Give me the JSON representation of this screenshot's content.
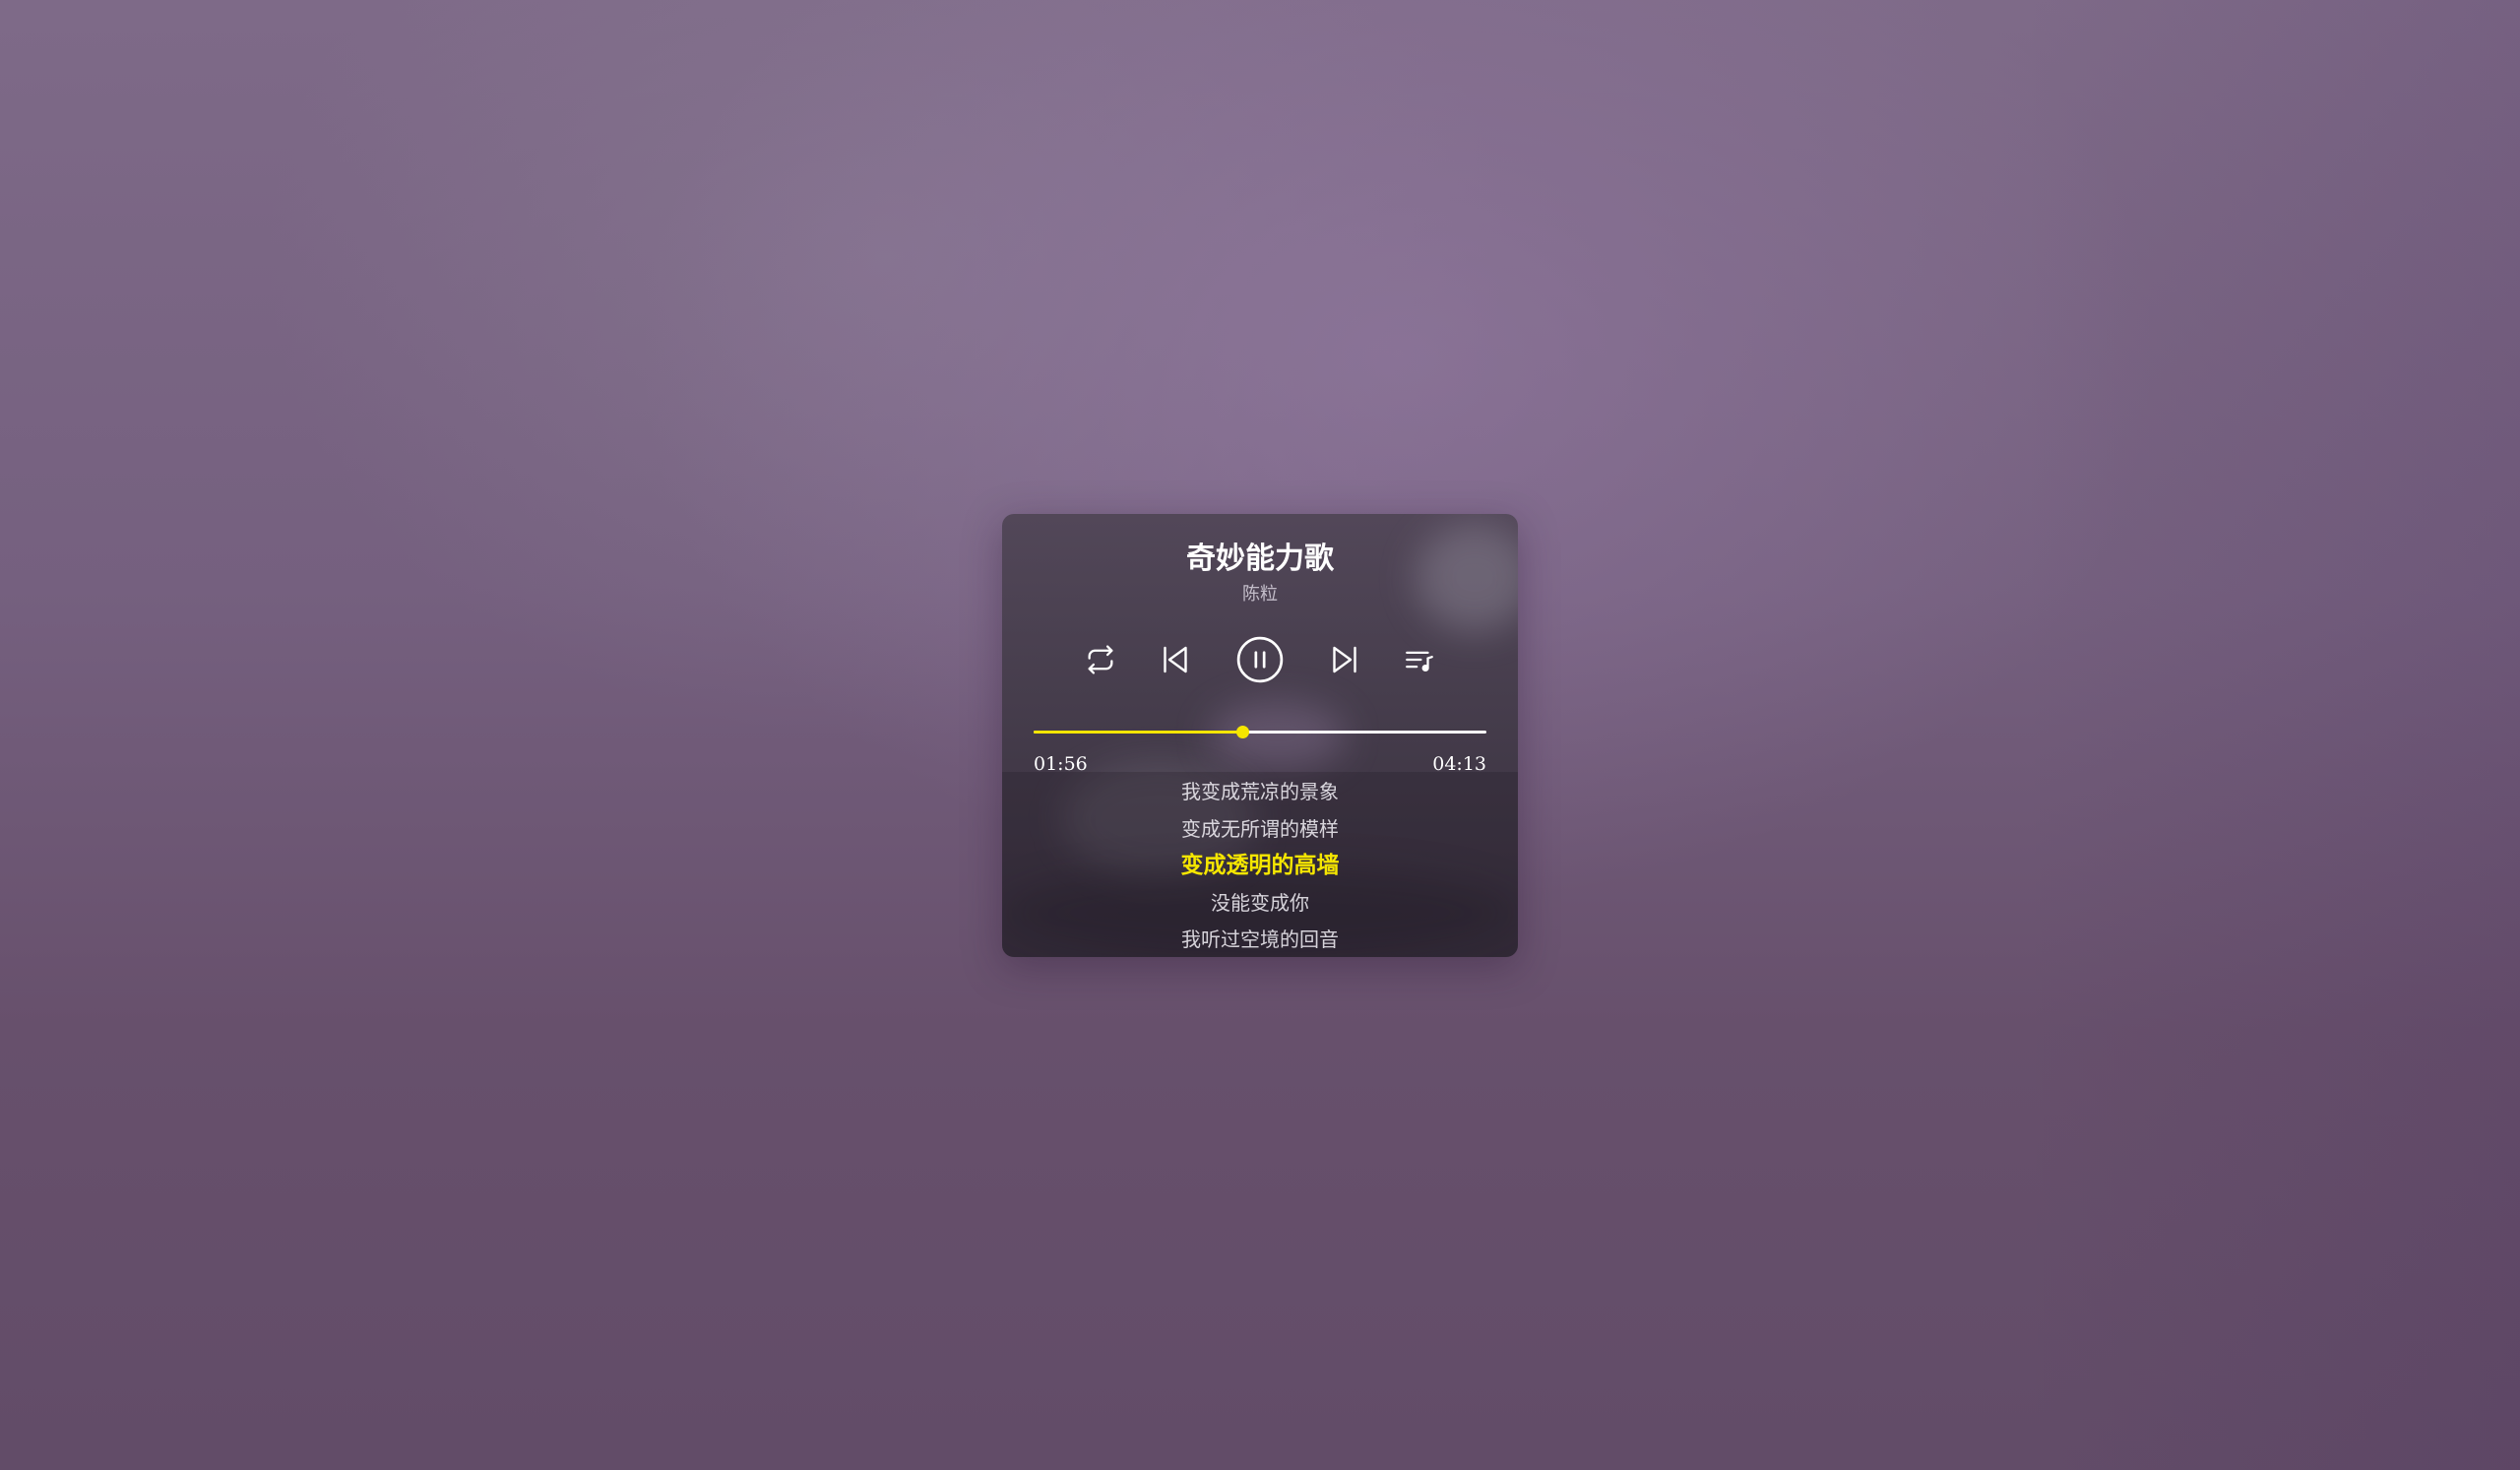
{
  "song": {
    "title": "奇妙能力歌",
    "artist": "陈粒"
  },
  "controls": {
    "repeat_icon": "repeat-icon",
    "previous_icon": "skip-previous-icon",
    "play_pause_icon": "pause-circle-icon",
    "next_icon": "skip-next-icon",
    "playlist_icon": "playlist-icon"
  },
  "progress": {
    "current": "01:56",
    "total": "04:13",
    "fraction": 0.46,
    "fill_color": "#f5e600",
    "track_color": "#ffffff"
  },
  "lyrics": [
    {
      "text": "我变成荒凉的景象",
      "active": false
    },
    {
      "text": "变成无所谓的模样",
      "active": false
    },
    {
      "text": "变成透明的高墙",
      "active": true
    },
    {
      "text": "没能变成你",
      "active": false
    },
    {
      "text": "我听过空境的回音",
      "active": false
    }
  ],
  "colors": {
    "accent": "#f5e600",
    "text": "#ffffff"
  }
}
